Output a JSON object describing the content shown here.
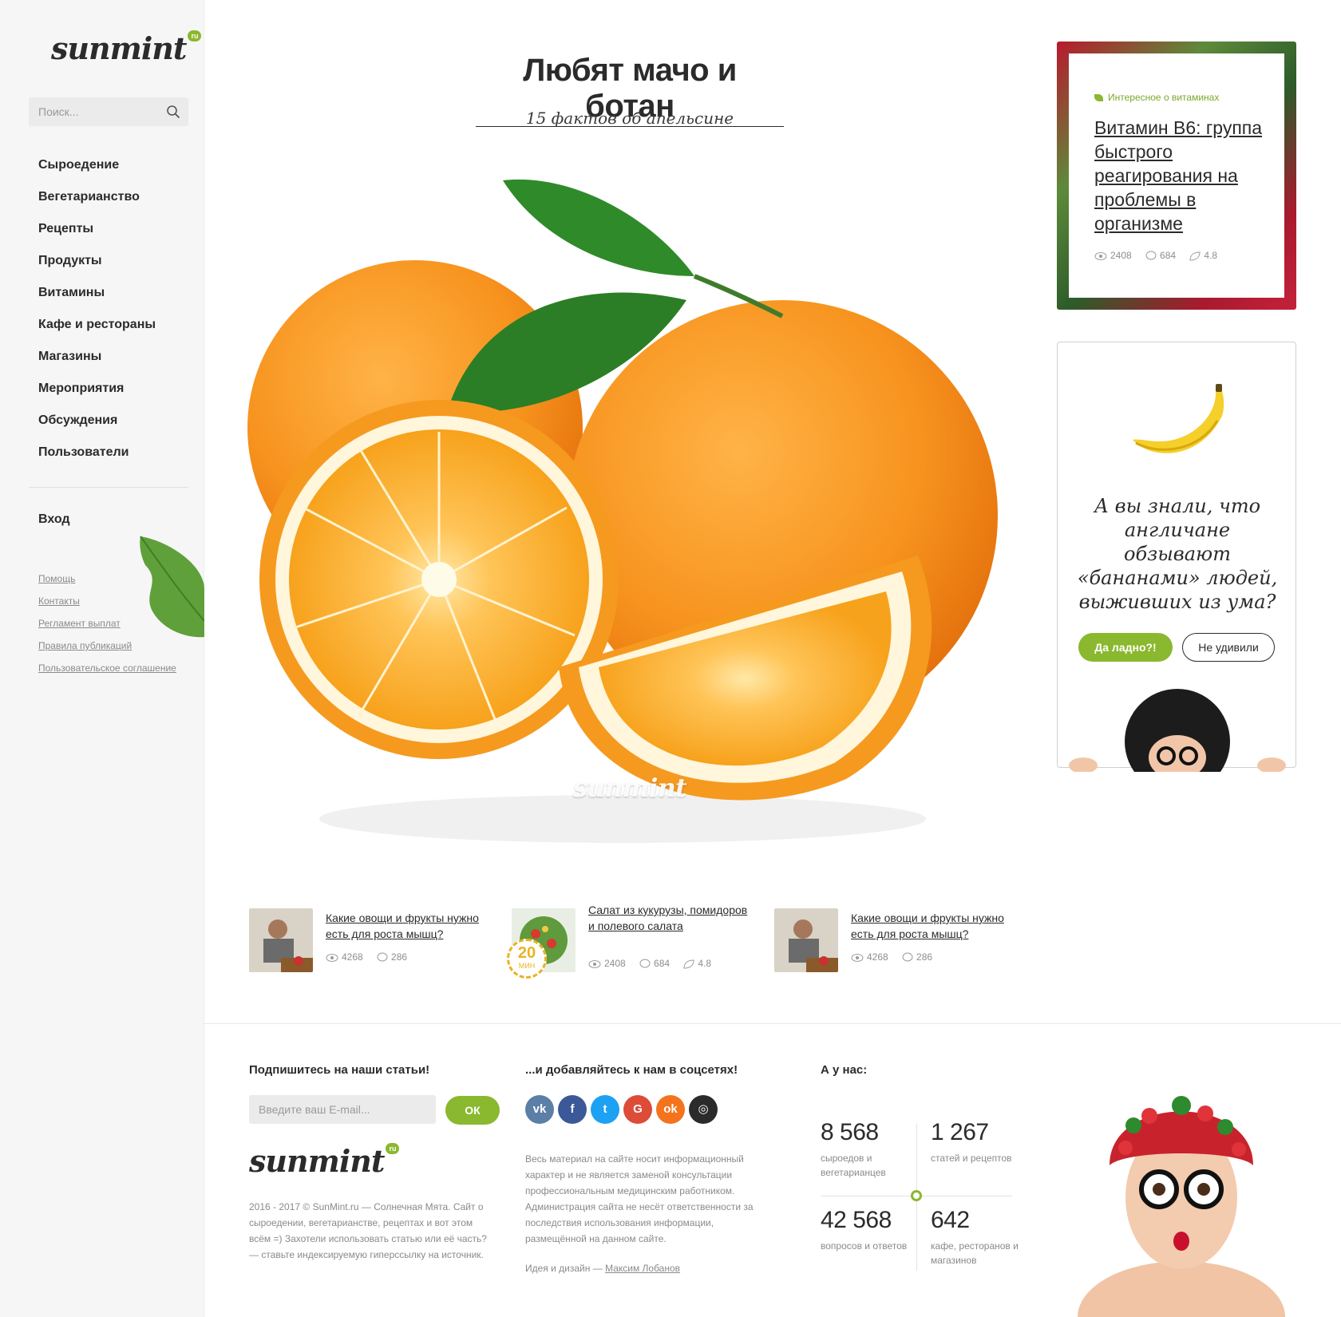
{
  "brand": {
    "logo_text": "sunmint",
    "logo_badge": "ru"
  },
  "search": {
    "placeholder": "Поиск..."
  },
  "nav": {
    "items": [
      "Сыроедение",
      "Вегетарианство",
      "Рецепты",
      "Продукты",
      "Витамины",
      "Кафе и рестораны",
      "Магазины",
      "Мероприятия",
      "Обсуждения",
      "Пользователи"
    ],
    "login": "Вход",
    "sublinks": [
      "Помощь",
      "Контакты",
      "Регламент выплат",
      "Правила публикаций",
      "Пользовательское соглашение"
    ]
  },
  "article": {
    "title": "Любят мачо и ботан",
    "subtitle": "15 фактов об апельсине",
    "watermark": "sunmint"
  },
  "related": [
    {
      "title": "Какие овощи и фрукты нужно есть для роста мышц?",
      "views": "4268",
      "comments": "286"
    },
    {
      "title": "Салат из кукурузы, помидоров и полевого салата",
      "views": "2408",
      "comments": "684",
      "rating": "4.8",
      "badge_number": "20",
      "badge_unit": "МИН"
    },
    {
      "title": "Какие овощи и фрукты нужно есть для роста мышц?",
      "views": "4268",
      "comments": "286"
    }
  ],
  "promo": {
    "category": "Интересное о витаминах",
    "title": "Витамин В6: группа быстрого реагирования на проблемы в организме",
    "views": "2408",
    "comments": "684",
    "rating": "4.8"
  },
  "quiz": {
    "question": "А вы знали, что англичане обзывают «бананами» людей, выживших из ума?",
    "yes_label": "Да ладно?!",
    "no_label": "Не удивили"
  },
  "footer": {
    "subscribe_heading": "Подпишитесь на наши статьи!",
    "email_placeholder": "Введите ваш E-mail...",
    "ok_label": "ОК",
    "copyright": "2016 - 2017 © SunMint.ru — Солнечная Мята. Сайт о сыроедении, вегетарианстве, рецептах и вот этом всём =) Захотели использовать статью или её часть? — ставьте индексируемую гиперссылку на источник.",
    "social_heading": "...и добавляйтесь к нам в соцсетях!",
    "socials": [
      {
        "name": "vk",
        "glyph": "vk",
        "color": "#5b7fa6"
      },
      {
        "name": "facebook",
        "glyph": "f",
        "color": "#3b5998"
      },
      {
        "name": "twitter",
        "glyph": "t",
        "color": "#1da1f2"
      },
      {
        "name": "google",
        "glyph": "G",
        "color": "#dd4b39"
      },
      {
        "name": "odnoklassniki",
        "glyph": "ok",
        "color": "#f4731c"
      },
      {
        "name": "instagram",
        "glyph": "◎",
        "color": "#2b2b2b"
      }
    ],
    "disclaimer": "Весь материал на сайте носит информационный характер и не является заменой консультации профессиональным медицинским работником. Администрация сайта не несёт ответственности за последствия использования информации, размещённой на данном сайте.",
    "credit_prefix": "Идея и дизайн — ",
    "credit_name": "Максим Лобанов",
    "stats_heading": "А у нас:",
    "stats": [
      {
        "number": "8 568",
        "label": "сыроедов и вегетарианцев"
      },
      {
        "number": "1 267",
        "label": "статей и рецептов"
      },
      {
        "number": "42 568",
        "label": "вопросов и ответов"
      },
      {
        "number": "642",
        "label": "кафе, ресторанов и магазинов"
      }
    ]
  },
  "colors": {
    "accent": "#8ab82e",
    "text": "#2b2b2b",
    "muted": "#8a8a8a",
    "sidebar_bg": "#f6f6f6"
  }
}
